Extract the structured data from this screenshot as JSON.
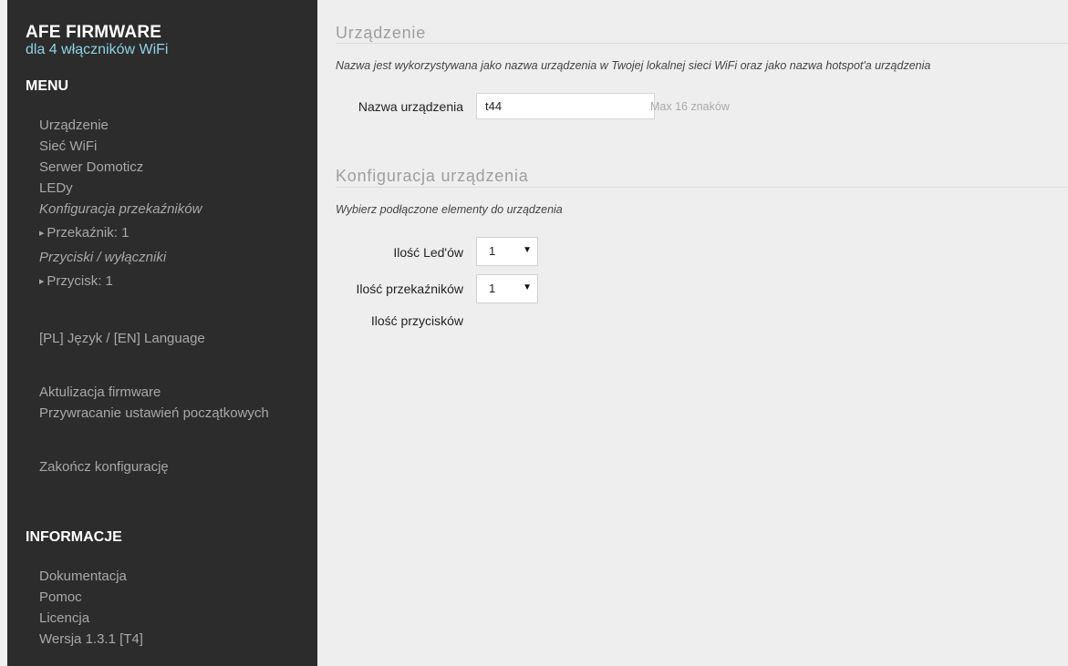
{
  "brand": {
    "title": "AFE FIRMWARE",
    "subtitle": "dla 4 włączników WiFi"
  },
  "sidebar": {
    "menu_heading": "MENU",
    "menu_items": [
      {
        "label": "Urządzenie"
      },
      {
        "label": "Sieć WiFi"
      },
      {
        "label": "Serwer Domoticz"
      },
      {
        "label": "LEDy"
      },
      {
        "label": "Konfiguracja przekaźników"
      },
      {
        "label": "Przekaźnik: 1"
      },
      {
        "label": "Przyciski / wyłączniki"
      },
      {
        "label": "Przycisk: 1"
      },
      {
        "label": "[PL] Język / [EN] Language"
      },
      {
        "label": "Aktulizacja firmware"
      },
      {
        "label": "Przywracanie ustawień początkowych"
      },
      {
        "label": "Zakończ konfigurację"
      }
    ],
    "info_heading": "INFORMACJE",
    "info_items": [
      {
        "label": "Dokumentacja"
      },
      {
        "label": "Pomoc"
      },
      {
        "label": "Licencja"
      },
      {
        "label": "Wersja 1.3.1 [T4]"
      }
    ]
  },
  "device_section": {
    "title": "Urządzenie",
    "description": "Nazwa jest wykorzystywana jako nazwa urządzenia w Twojej lokalnej sieci WiFi oraz jako nazwa hotspot'a urządzenia",
    "name_label": "Nazwa urządzenia",
    "name_value": "t44",
    "name_hint": "Max 16 znaków"
  },
  "config_section": {
    "title": "Konfiguracja urządzenia",
    "description": "Wybierz podłączone elementy do urządzenia",
    "led_label": "Ilość Led'ów",
    "led_value": "1",
    "relay_label": "Ilość przekaźników",
    "relay_value": "1",
    "buttons_label": "Ilość przycisków"
  },
  "icons": {
    "dropdown": "caret-down-icon",
    "submenu": "triangle-right-icon"
  },
  "colors": {
    "sidebar_bg": "#2c2c2c",
    "accent": "#8fd1e3",
    "content_bg": "#eeeeee"
  }
}
